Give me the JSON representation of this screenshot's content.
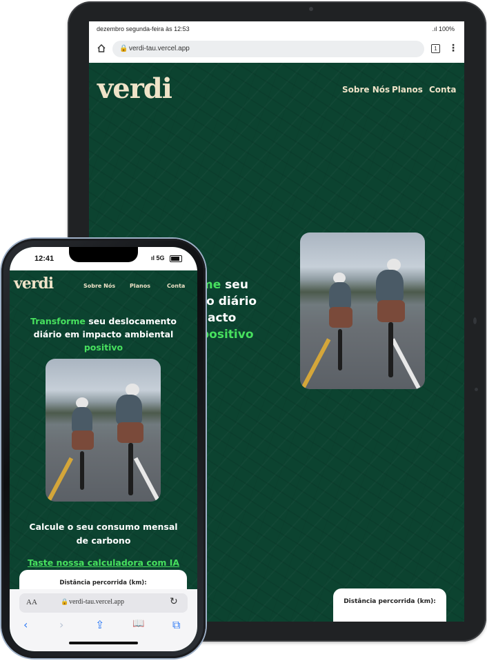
{
  "tablet": {
    "status": {
      "left": "dezembro segunda-feira às 12:53",
      "right": ".ıl 100%"
    },
    "browser": {
      "url": "verdi-tau.vercel.app",
      "tabs_count": "1",
      "menu": "⋮"
    },
    "site": {
      "logo": "verdi",
      "nav": [
        "Sobre Nós",
        "Planos",
        "Conta"
      ],
      "hero_lines": [
        {
          "pre": "",
          "green": "me",
          "post": " seu"
        },
        {
          "pre": "to diário",
          "green": "",
          "post": ""
        },
        {
          "pre": "acto",
          "green": "",
          "post": ""
        },
        {
          "pre": "",
          "green": "positivo",
          "post": ""
        }
      ],
      "card_label": "Distância percorrida (km):"
    }
  },
  "phone": {
    "status": {
      "time": "12:41",
      "icons": "ıl 5G"
    },
    "site": {
      "logo": "verdi",
      "nav": [
        "Sobre Nós",
        "Planos",
        "Conta"
      ],
      "hero": {
        "green1": "Transforme",
        "white1": " seu deslocamento diário em impacto ambiental",
        "green2": "positivo"
      },
      "calc_title": "Calcule o seu consumo mensal de carbono",
      "calc_link": "Taste nossa calculadora com IA",
      "card_label": "Distância percorrida (km):"
    },
    "safari": {
      "aa": "AA",
      "url": "verdi-tau.vercel.app",
      "reload": "↻",
      "tools": [
        "‹",
        "›",
        "⇪",
        "📖",
        "⧉"
      ]
    }
  },
  "colors": {
    "brand_green": "#0c4330",
    "accent_green": "#47e05e",
    "logo_cream": "#efe3c8"
  }
}
